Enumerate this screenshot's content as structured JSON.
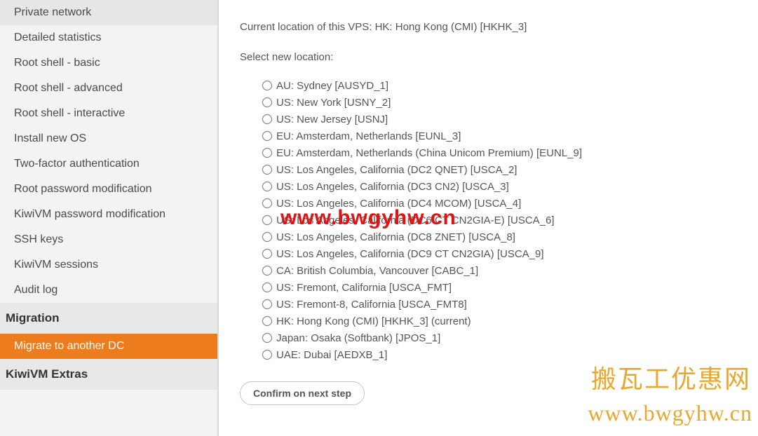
{
  "sidebar": {
    "items_top": [
      {
        "label": "Private network"
      },
      {
        "label": "Detailed statistics"
      },
      {
        "label": "Root shell - basic"
      },
      {
        "label": "Root shell - advanced"
      },
      {
        "label": "Root shell - interactive"
      },
      {
        "label": "Install new OS"
      },
      {
        "label": "Two-factor authentication"
      },
      {
        "label": "Root password modification"
      },
      {
        "label": "KiwiVM password modification"
      },
      {
        "label": "SSH keys"
      },
      {
        "label": "KiwiVM sessions"
      },
      {
        "label": "Audit log"
      }
    ],
    "section_migration": "Migration",
    "migration_items": [
      {
        "label": "Migrate to another DC",
        "active": true
      }
    ],
    "section_extras": "KiwiVM Extras"
  },
  "main": {
    "current_location_label": "Current location of this VPS: HK: Hong Kong (CMI) [HKHK_3]",
    "select_label": "Select new location:",
    "locations": [
      "AU: Sydney [AUSYD_1]",
      "US: New York [USNY_2]",
      "US: New Jersey [USNJ]",
      "EU: Amsterdam, Netherlands [EUNL_3]",
      "EU: Amsterdam, Netherlands (China Unicom Premium) [EUNL_9]",
      "US: Los Angeles, California (DC2 QNET) [USCA_2]",
      "US: Los Angeles, California (DC3 CN2) [USCA_3]",
      "US: Los Angeles, California (DC4 MCOM) [USCA_4]",
      "US: Los Angeles, California (DC6 CT CN2GIA-E) [USCA_6]",
      "US: Los Angeles, California (DC8 ZNET) [USCA_8]",
      "US: Los Angeles, California (DC9 CT CN2GIA) [USCA_9]",
      "CA: British Columbia, Vancouver [CABC_1]",
      "US: Fremont, California [USCA_FMT]",
      "US: Fremont-8, California [USCA_FMT8]",
      "HK: Hong Kong (CMI) [HKHK_3] (current)",
      "Japan: Osaka (Softbank) [JPOS_1]",
      "UAE: Dubai [AEDXB_1]"
    ],
    "confirm_label": "Confirm on next step"
  },
  "watermarks": {
    "center": "www.bwgyhw.cn",
    "corner_cn": "搬瓦工优惠网",
    "corner_url": "www.bwgyhw.cn"
  }
}
